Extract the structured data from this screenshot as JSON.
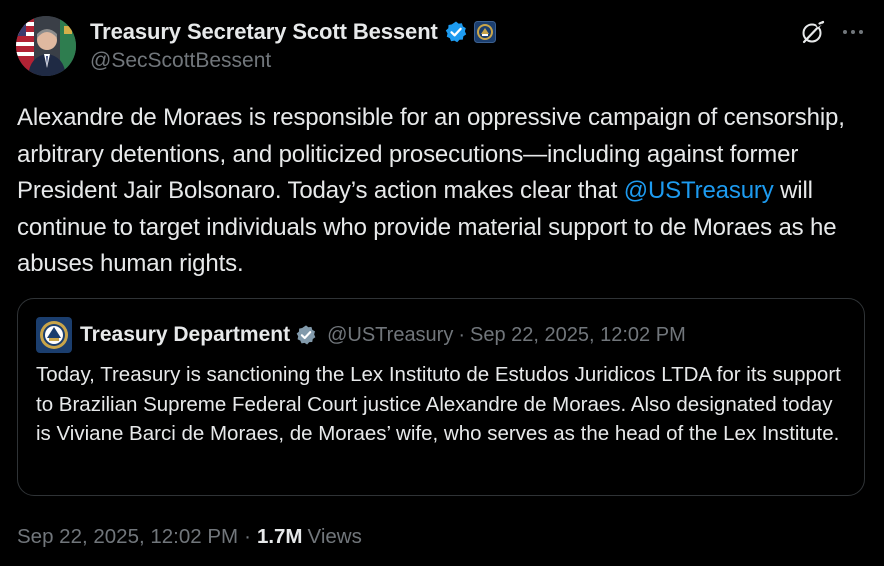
{
  "author": {
    "display_name": "Treasury Secretary Scott Bessent",
    "handle": "@SecScottBessent",
    "verified_icon": "verified-badge-icon",
    "affiliation_icon": "treasury-seal-icon"
  },
  "actions": {
    "grok_icon": "grok-icon",
    "more_icon": "more-options-icon"
  },
  "tweet": {
    "text_part1": "Alexandre de Moraes is responsible for an oppressive campaign of censorship, arbitrary detentions, and politicized prosecutions—including against former President Jair Bolsonaro. Today’s action makes clear that ",
    "mention": "@USTreasury",
    "text_part2": " will continue to target individuals who provide material support to de Moraes as he abuses human rights."
  },
  "quote": {
    "display_name": "Treasury Department",
    "handle": "@USTreasury",
    "separator": "·",
    "timestamp": "Sep 22, 2025, 12:02 PM",
    "text": "Today, Treasury is sanctioning the Lex Instituto de Estudos Juridicos LTDA for its support to Brazilian Supreme Federal Court justice Alexandre de Moraes. Also designated today is Viviane Barci de Moraes, de Moraes’ wife, who serves as the head of the Lex Institute."
  },
  "footer": {
    "timestamp": "Sep 22, 2025, 12:02 PM",
    "separator": "·",
    "view_count": "1.7M",
    "views_label": "Views"
  },
  "colors": {
    "background": "#000000",
    "text_primary": "#e7e9ea",
    "text_secondary": "#71767b",
    "accent": "#1d9bf0",
    "border": "#2f3336",
    "verified_blue": "#1d9bf0"
  }
}
